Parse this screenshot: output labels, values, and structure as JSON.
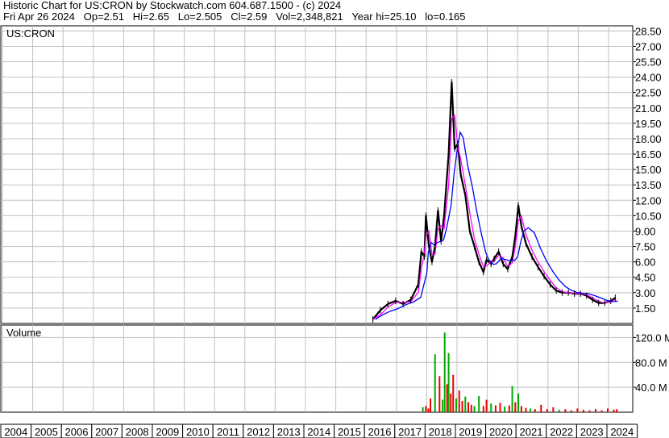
{
  "header": {
    "line1": "Historic Chart for US:CRON by Stockwatch.com 604.687.1500 - (c) 2024",
    "line2": "Fri Apr 26 2024   Op=2.51   Hi=2.65   Lo=2.505   Cl=2.59   Vol=2,348,821   Year hi=25.10   lo=0.165"
  },
  "price_panel": {
    "label": "US:CRON"
  },
  "volume_panel": {
    "label": "Volume"
  },
  "colors": {
    "bars": "#000000",
    "ma_short": "#ff00ff",
    "ma_long": "#0000ff",
    "vol_up": "#00aa00",
    "vol_down": "#ee0000",
    "grid": "#c0c0c0"
  },
  "chart_data": [
    {
      "type": "line",
      "title": "Historic Chart for US:CRON",
      "x_ticks": [
        "2004",
        "2005",
        "2006",
        "2007",
        "2008",
        "2009",
        "2010",
        "2011",
        "2012",
        "2013",
        "2014",
        "2015",
        "2016",
        "2017",
        "2018",
        "2019",
        "2020",
        "2021",
        "2022",
        "2023",
        "2024"
      ],
      "y_ticks": [
        "1.50",
        "3.00",
        "4.50",
        "6.00",
        "7.50",
        "9.00",
        "10.50",
        "12.00",
        "13.50",
        "15.00",
        "16.50",
        "18.00",
        "19.50",
        "21.00",
        "22.50",
        "24.00",
        "25.50",
        "27.00",
        "28.50"
      ],
      "ylim": [
        0,
        29
      ],
      "grid": true,
      "series": [
        {
          "x": [
            2016.25,
            2016.5,
            2016.75,
            2017.0,
            2017.25,
            2017.5,
            2017.75,
            2017.85,
            2017.95,
            2018.0,
            2018.1,
            2018.2,
            2018.3,
            2018.4,
            2018.5,
            2018.6,
            2018.75,
            2018.85,
            2018.95,
            2019.05,
            2019.15,
            2019.3,
            2019.45,
            2019.6,
            2019.75,
            2019.9,
            2020.0,
            2020.15,
            2020.25,
            2020.4,
            2020.55,
            2020.7,
            2020.85,
            2020.95,
            2021.05,
            2021.15,
            2021.3,
            2021.5,
            2021.7,
            2021.9,
            2022.1,
            2022.3,
            2022.5,
            2022.7,
            2022.9,
            2023.1,
            2023.3,
            2023.5,
            2023.7,
            2023.9,
            2024.1,
            2024.25
          ],
          "y": [
            0.4,
            1.3,
            1.9,
            2.2,
            1.9,
            2.3,
            3.8,
            7.0,
            6.5,
            10.5,
            7.5,
            6.0,
            7.5,
            11.0,
            8.0,
            10.5,
            16.5,
            23.5,
            17.0,
            17.5,
            14.5,
            12.5,
            9.0,
            7.5,
            6.0,
            5.0,
            6.2,
            5.8,
            6.3,
            7.0,
            5.8,
            5.3,
            6.5,
            8.5,
            11.5,
            9.5,
            7.8,
            6.5,
            5.5,
            4.6,
            3.8,
            3.2,
            3.0,
            3.0,
            2.9,
            2.9,
            2.7,
            2.3,
            2.0,
            2.0,
            2.2,
            2.5
          ]
        }
      ]
    },
    {
      "type": "bar",
      "title": "Volume",
      "y_ticks": [
        "40.0 M",
        "80.0 M",
        "120.0 M"
      ],
      "ylim": [
        0,
        140
      ],
      "x": [
        2017.9,
        2018.0,
        2018.08,
        2018.15,
        2018.3,
        2018.45,
        2018.55,
        2018.62,
        2018.7,
        2018.75,
        2018.82,
        2018.9,
        2019.0,
        2019.1,
        2019.2,
        2019.3,
        2019.4,
        2019.5,
        2019.6,
        2019.75,
        2019.9,
        2020.0,
        2020.15,
        2020.3,
        2020.45,
        2020.6,
        2020.75,
        2020.85,
        2020.95,
        2021.05,
        2021.15,
        2021.3,
        2021.45,
        2021.6,
        2021.8,
        2022.0,
        2022.2,
        2022.4,
        2022.6,
        2022.8,
        2023.0,
        2023.2,
        2023.4,
        2023.6,
        2023.8,
        2024.0,
        2024.2,
        2024.3
      ],
      "values": [
        8,
        10,
        6,
        22,
        93,
        58,
        20,
        128,
        45,
        95,
        30,
        60,
        22,
        35,
        18,
        25,
        16,
        12,
        10,
        26,
        10,
        20,
        14,
        11,
        15,
        9,
        11,
        42,
        16,
        30,
        10,
        7,
        6,
        5,
        12,
        5,
        8,
        4,
        5,
        3,
        6,
        4,
        3,
        5,
        3,
        6,
        4,
        5
      ],
      "colors": [
        "green",
        "red",
        "red",
        "red",
        "green",
        "red",
        "green",
        "green",
        "red",
        "green",
        "red",
        "red",
        "green",
        "red",
        "red",
        "green",
        "red",
        "red",
        "green",
        "green",
        "red",
        "red",
        "green",
        "red",
        "red",
        "green",
        "red",
        "green",
        "red",
        "green",
        "red",
        "red",
        "green",
        "red",
        "red",
        "red",
        "red",
        "green",
        "red",
        "red",
        "red",
        "red",
        "red",
        "red",
        "red",
        "red",
        "red",
        "red"
      ]
    }
  ]
}
